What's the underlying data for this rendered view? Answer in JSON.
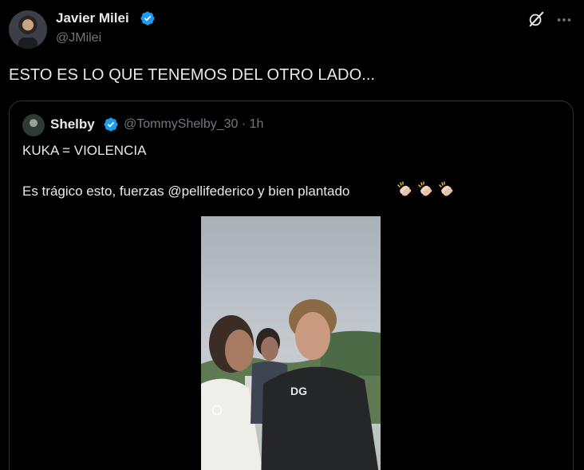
{
  "author": {
    "display_name": "Javier Milei",
    "handle": "@JMilei"
  },
  "tweet": {
    "text": "ESTO ES LO QUE TENEMOS DEL OTRO LADO..."
  },
  "header_icons": [
    "grok-icon",
    "more-icon"
  ],
  "quote": {
    "display_name": "Shelby",
    "handle_time": "@TommyShelby_30 · 1h",
    "line1": "KUKA = VIOLENCIA",
    "line2": "Es trágico esto, fuerzas @pellifederico y bien plantado",
    "emoji": "clapping-hands",
    "video_overlay_text": "DG"
  },
  "colors": {
    "background": "#000000",
    "text": "#e7e9ea",
    "muted": "#71767b",
    "verified": "#1d9bf0",
    "border": "#2f3336"
  }
}
